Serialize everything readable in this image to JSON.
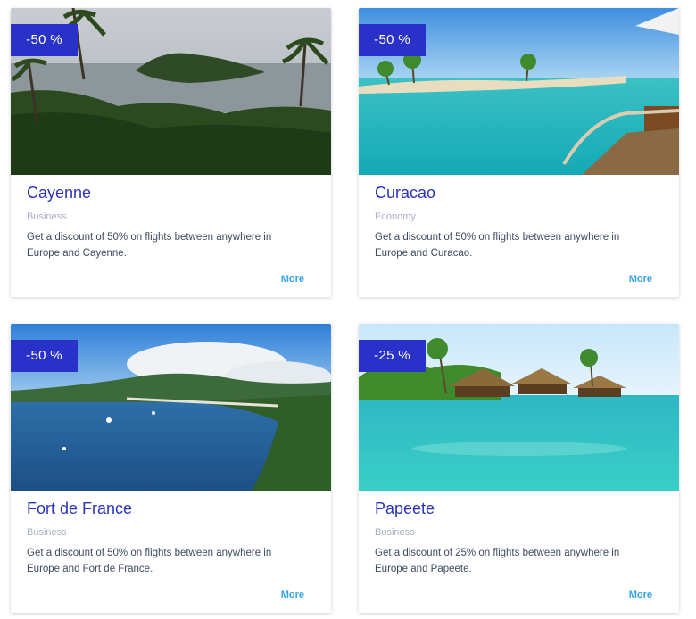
{
  "offers": [
    {
      "badge": "-50 %",
      "city": "Cayenne",
      "class": "Business",
      "description": "Get a discount of 50% on flights between anywhere in Europe and Cayenne.",
      "more": "More"
    },
    {
      "badge": "-50 %",
      "city": "Curacao",
      "class": "Economy",
      "description": "Get a discount of 50% on flights between anywhere in Europe and Curacao.",
      "more": "More"
    },
    {
      "badge": "-50 %",
      "city": "Fort de France",
      "class": "Business",
      "description": "Get a discount of 50% on flights between anywhere in Europe and Fort de France.",
      "more": "More"
    },
    {
      "badge": "-25 %",
      "city": "Papeete",
      "class": "Business",
      "description": "Get a discount of 25% on flights between anywhere in Europe and Papeete.",
      "more": "More"
    }
  ],
  "colors": {
    "badge": "#2a31c9",
    "title": "#2c33b8",
    "link": "#34a3e6"
  }
}
